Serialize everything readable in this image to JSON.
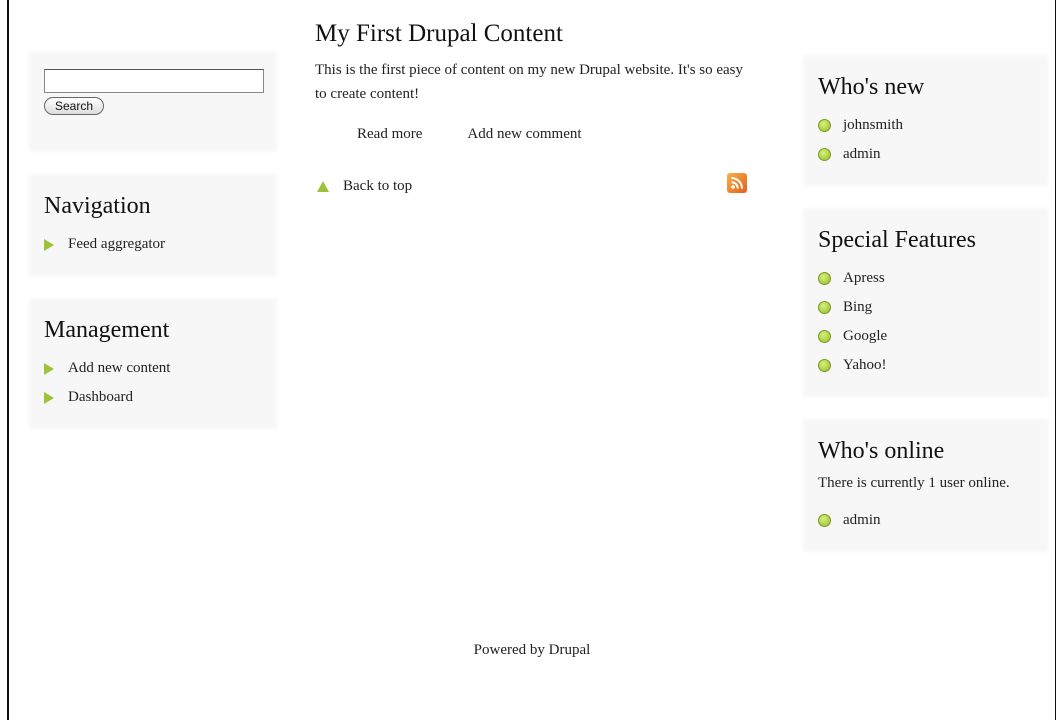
{
  "search": {
    "input_value": "",
    "button_label": "Search"
  },
  "navigation": {
    "title": "Navigation",
    "items": [
      {
        "label": "Feed aggregator"
      }
    ]
  },
  "management": {
    "title": "Management",
    "items": [
      {
        "label": "Add new content"
      },
      {
        "label": "Dashboard"
      }
    ]
  },
  "node": {
    "title": "My First Drupal Content",
    "body": "This is the first piece of content on my new Drupal website. It's so easy to create content!",
    "links": {
      "read_more": "Read more",
      "add_comment": "Add new comment"
    }
  },
  "back_to_top": "Back to top",
  "whos_new": {
    "title": "Who's new",
    "users": [
      {
        "name": "johnsmith"
      },
      {
        "name": "admin"
      }
    ]
  },
  "special_features": {
    "title": "Special Features",
    "items": [
      {
        "label": "Apress"
      },
      {
        "label": "Bing"
      },
      {
        "label": "Google"
      },
      {
        "label": "Yahoo!"
      }
    ]
  },
  "whos_online": {
    "title": "Who's online",
    "status_text": "There is currently 1 user online.",
    "users": [
      {
        "name": "admin"
      }
    ]
  },
  "footer": {
    "text": "Powered by Drupal"
  },
  "colors": {
    "bullet_green": "#9cc43a",
    "rss_orange": "#e8711f",
    "block_bg": "#f7f7f7"
  }
}
